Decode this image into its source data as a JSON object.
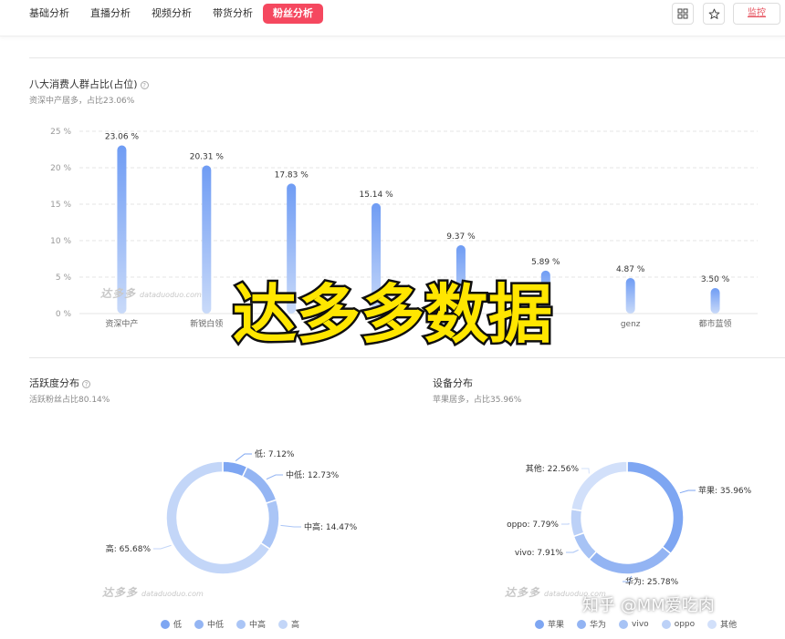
{
  "tabs": [
    {
      "label": "基础分析",
      "active": false
    },
    {
      "label": "直播分析",
      "active": false
    },
    {
      "label": "视频分析",
      "active": false
    },
    {
      "label": "带货分析",
      "active": false
    },
    {
      "label": "粉丝分析",
      "active": true
    }
  ],
  "toolbar": {
    "grid_icon": "grid-icon",
    "star_icon": "star-icon",
    "monitor_label": "监控"
  },
  "consumer_section": {
    "title": "八大消费人群占比(占位)",
    "subtitle": "资深中产居多，占比23.06%"
  },
  "activity_section": {
    "title": "活跃度分布",
    "subtitle": "活跃粉丝占比80.14%"
  },
  "device_section": {
    "title": "设备分布",
    "subtitle": "苹果居多，占比35.96%"
  },
  "watermark": {
    "brand": "达多多",
    "url": "dataduoduo.com"
  },
  "overlay": {
    "text": "达多多数据"
  },
  "corner_mark": {
    "text": "知乎 @MM爱吃肉"
  },
  "colors": {
    "accent": "#f5485f",
    "bar_top": "#6f9cf4",
    "bar_bottom": "#c9daf9"
  },
  "chart_data": [
    {
      "type": "bar",
      "categories": [
        "资深中产",
        "新锐白领",
        "",
        "",
        "",
        "",
        "genz",
        "都市蓝领"
      ],
      "values": [
        23.06,
        20.31,
        17.83,
        15.14,
        9.37,
        5.89,
        4.87,
        3.5
      ],
      "value_labels": [
        "23.06 %",
        "20.31 %",
        "17.83 %",
        "15.14 %",
        "9.37 %",
        "5.89 %",
        "4.87 %",
        "3.50 %"
      ],
      "y_ticks": [
        "0 %",
        "5 %",
        "10 %",
        "15 %",
        "20 %",
        "25 %"
      ],
      "ylim": [
        0,
        25
      ],
      "grid": true
    },
    {
      "type": "pie",
      "labels": [
        "低",
        "中低",
        "中高",
        "高"
      ],
      "values": [
        7.12,
        12.73,
        14.47,
        65.68
      ],
      "slice_labels": [
        "低: 7.12%",
        "中低: 12.73%",
        "中高: 14.47%",
        "高: 65.68%"
      ],
      "colors": [
        "#7ea6f2",
        "#94b5f3",
        "#aac5f6",
        "#c3d6f8"
      ],
      "legend_position": "bottom"
    },
    {
      "type": "pie",
      "labels": [
        "苹果",
        "华为",
        "vivo",
        "oppo",
        "其他"
      ],
      "values": [
        35.96,
        25.78,
        7.91,
        7.79,
        22.56
      ],
      "slice_labels": [
        "苹果: 35.96%",
        "华为: 25.78%",
        "vivo: 7.91%",
        "oppo: 7.79%",
        "其他: 22.56%"
      ],
      "colors": [
        "#7ea6f2",
        "#93b4f3",
        "#a7c3f5",
        "#bcd1f7",
        "#d2e0fa"
      ],
      "legend_position": "bottom"
    }
  ]
}
